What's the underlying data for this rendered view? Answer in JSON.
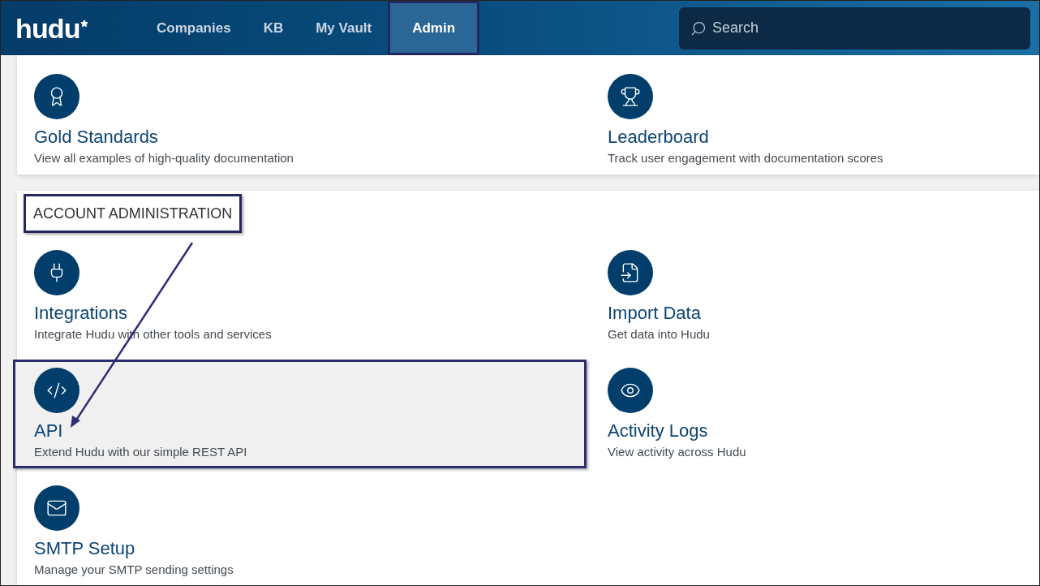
{
  "header": {
    "logo": "hudu",
    "nav": [
      {
        "label": "Companies",
        "selected": false,
        "outlined": false
      },
      {
        "label": "KB",
        "selected": false,
        "outlined": false
      },
      {
        "label": "My Vault",
        "selected": false,
        "outlined": false
      },
      {
        "label": "Admin",
        "selected": true,
        "outlined": true
      }
    ],
    "search": {
      "placeholder": "Search"
    }
  },
  "sections": [
    {
      "items": [
        {
          "title": "Gold Standards",
          "description": "View all examples of high-quality documentation",
          "highlighted": false
        },
        {
          "title": "Leaderboard",
          "description": "Track user engagement with documentation scores",
          "highlighted": false
        }
      ]
    },
    {
      "heading": {
        "text": "ACCOUNT ADMINISTRATION",
        "outlined": true
      },
      "items": [
        {
          "title": "Integrations",
          "description": "Integrate Hudu with other tools and services",
          "highlighted": false
        },
        {
          "title": "Import Data",
          "description": "Get data into Hudu",
          "highlighted": false
        },
        {
          "title": "API",
          "description": "Extend Hudu with our simple REST API",
          "highlighted": true
        },
        {
          "title": "Activity Logs",
          "description": "View activity across Hudu",
          "highlighted": false
        },
        {
          "title": "SMTP Setup",
          "description": "Manage your SMTP sending settings",
          "highlighted": false
        }
      ]
    }
  ]
}
